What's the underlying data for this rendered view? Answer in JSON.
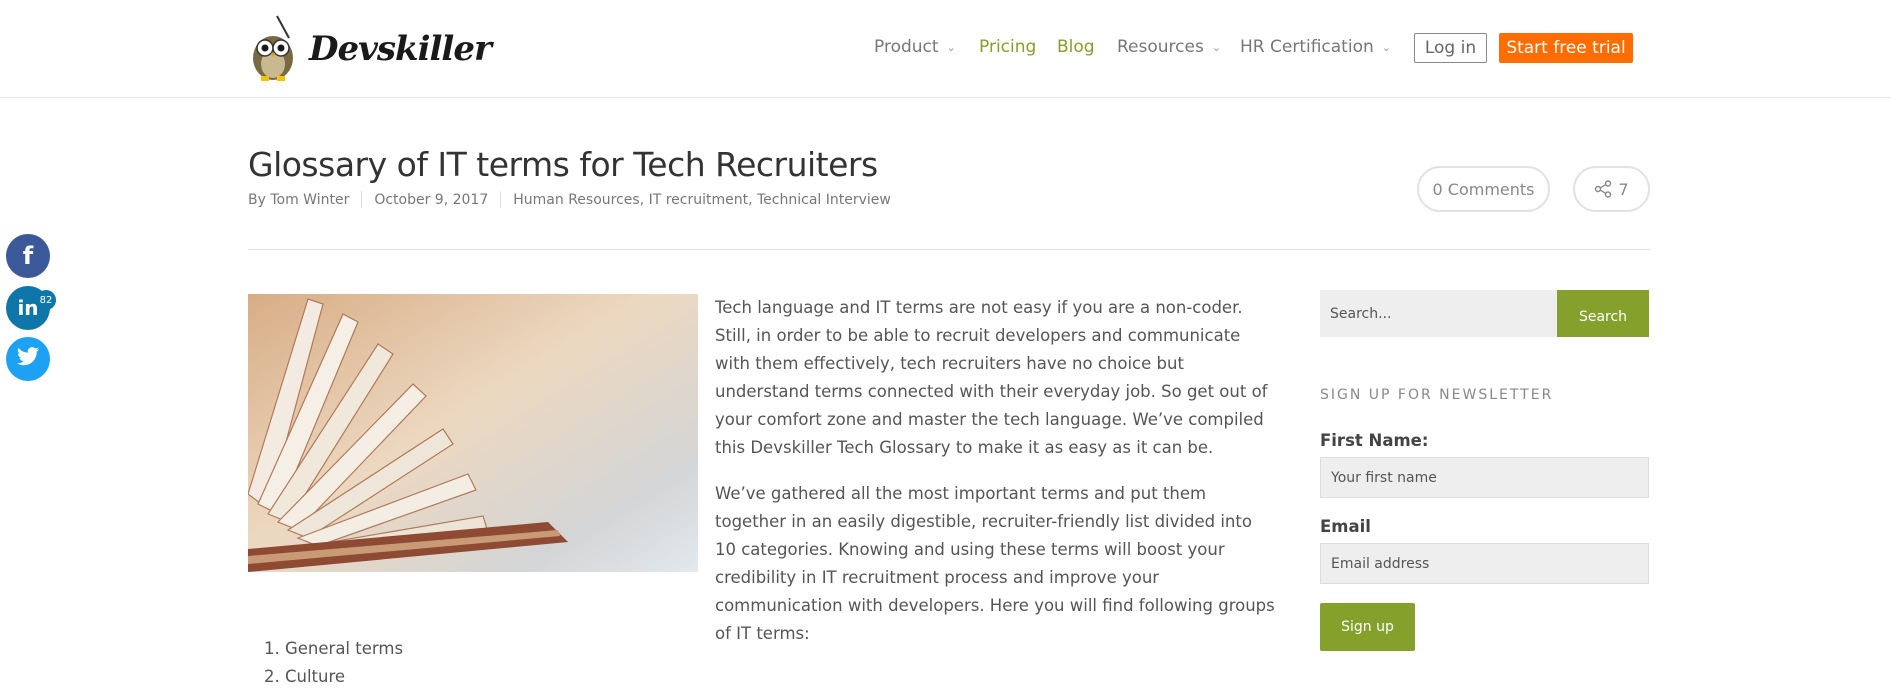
{
  "header": {
    "logo_text": "Devskiller",
    "nav": [
      {
        "label": "Product",
        "dropdown": true
      },
      {
        "label": "Pricing"
      },
      {
        "label": "Blog"
      },
      {
        "label": "Resources",
        "dropdown": true
      },
      {
        "label": "HR Certification",
        "dropdown": true
      }
    ],
    "login_label": "Log in",
    "trial_label": "Start free trial"
  },
  "post": {
    "title": "Glossary of IT terms for Tech Recruiters",
    "author": "By Tom Winter",
    "date": "October 9, 2017",
    "categories": "Human Resources, IT recruitment, Technical Interview",
    "comments": "0 Comments",
    "shares": "7",
    "paragraph1": "Tech language and IT terms are not easy if you are a non-coder. Still, in order to be able to recruit developers and communicate with them effectively, tech recruiters have no choice but understand terms connected with their everyday job. So get out of your comfort zone and master the tech language. We’ve compiled this Devskiller Tech Glossary to make it as easy as it can be.",
    "paragraph2": "We’ve gathered all the most important terms and put them together in an easily digestible, recruiter-friendly list divided into 10 categories. Knowing and using these terms will boost your credibility in IT recruitment process and improve your communication with developers. Here you will find following groups of IT terms:",
    "list": [
      "1. General terms",
      "2. Culture"
    ]
  },
  "social": {
    "linkedin_count": "82",
    "icons": [
      "facebook-icon",
      "linkedin-icon",
      "twitter-icon"
    ]
  },
  "sidebar": {
    "search_placeholder": "Search...",
    "search_button": "Search",
    "newsletter_heading": "SIGN UP FOR NEWSLETTER",
    "first_name_label": "First Name:",
    "first_name_placeholder": "Your first name",
    "email_label": "Email",
    "email_placeholder": "Email address",
    "signup_button": "Sign up"
  },
  "colors": {
    "brand_green": "#86a02c",
    "trial_orange": "#ff6d00",
    "facebook": "#3b5998",
    "linkedin": "#0e76a8",
    "twitter": "#1da1f2"
  }
}
